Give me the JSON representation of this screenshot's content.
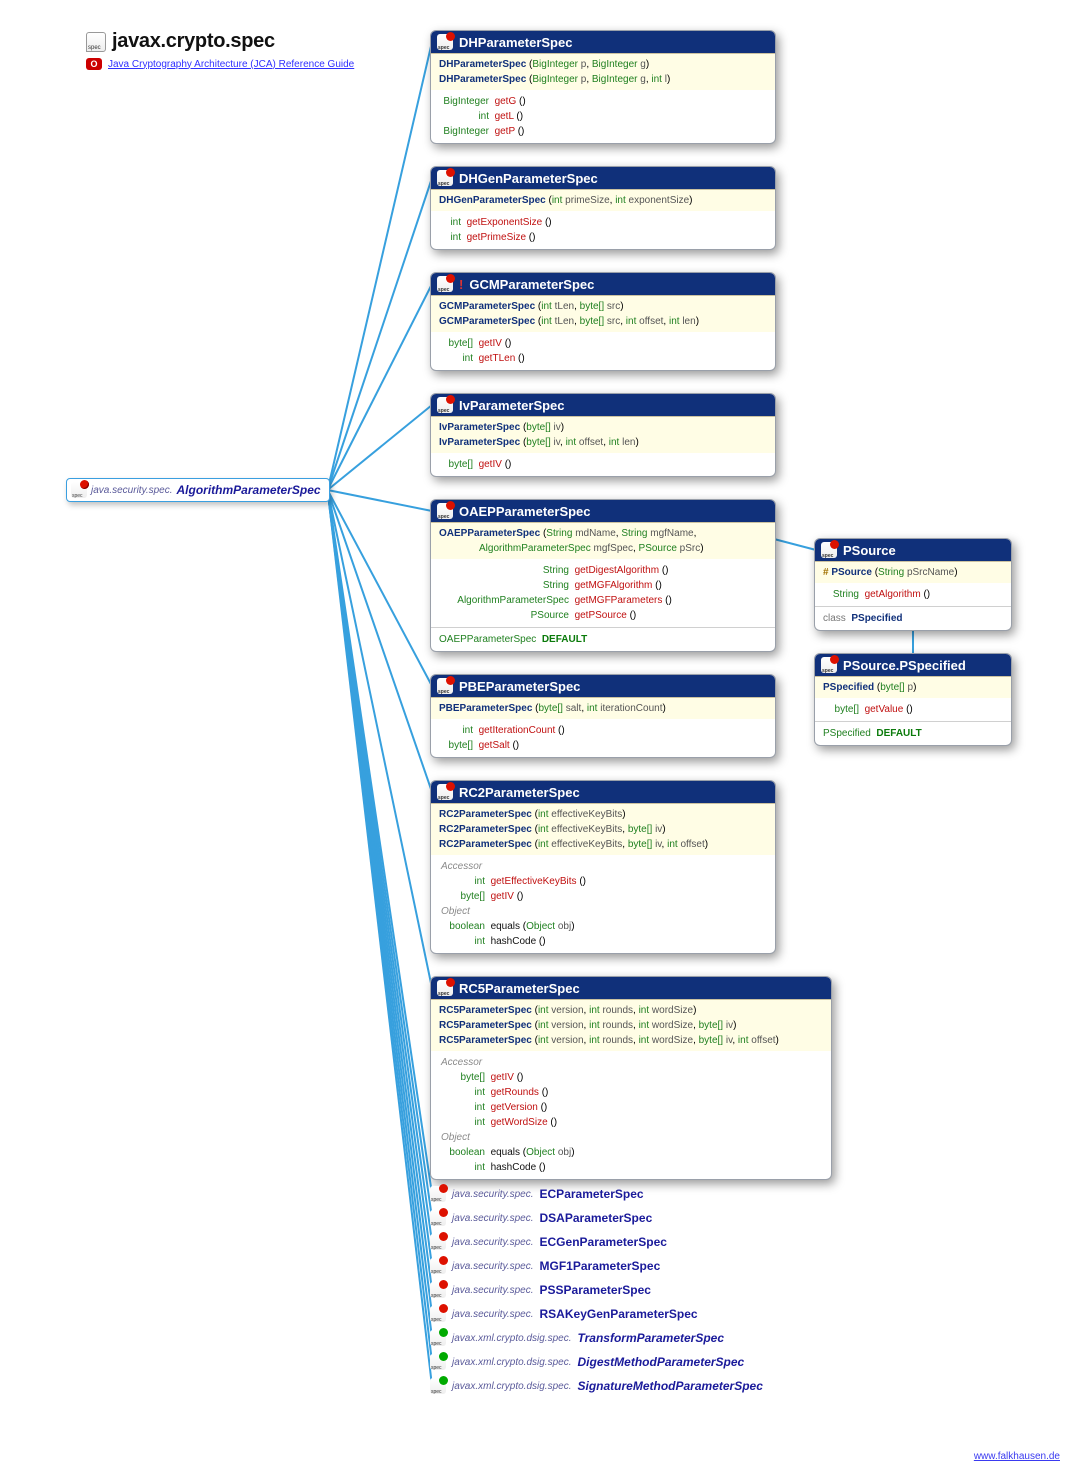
{
  "title": "javax.crypto.spec",
  "reference_link": "Java Cryptography Architecture (JCA) Reference Guide",
  "root": {
    "package": "java.security.spec.",
    "class": "AlgorithmParameterSpec"
  },
  "boxes": [
    {
      "name": "DHParameterSpec",
      "ctors": [
        {
          "n": "DHParameterSpec",
          "args": [
            [
              "BigInteger",
              "p"
            ],
            [
              "BigInteger",
              "g"
            ]
          ]
        },
        {
          "n": "DHParameterSpec",
          "args": [
            [
              "BigInteger",
              "p"
            ],
            [
              "BigInteger",
              "g"
            ],
            [
              "int",
              "l"
            ]
          ]
        }
      ],
      "methods": [
        [
          "BigInteger",
          "getG"
        ],
        [
          "int",
          "getL"
        ],
        [
          "BigInteger",
          "getP"
        ]
      ],
      "rcol": 50
    },
    {
      "name": "DHGenParameterSpec",
      "ctors": [
        {
          "n": "DHGenParameterSpec",
          "args": [
            [
              "int",
              "primeSize"
            ],
            [
              "int",
              "exponentSize"
            ]
          ]
        }
      ],
      "methods": [
        [
          "int",
          "getExponentSize"
        ],
        [
          "int",
          "getPrimeSize"
        ]
      ],
      "rcol": 22
    },
    {
      "name": "GCMParameterSpec",
      "bang": true,
      "ctors": [
        {
          "n": "GCMParameterSpec",
          "args": [
            [
              "int",
              "tLen"
            ],
            [
              "byte[]",
              "src"
            ]
          ]
        },
        {
          "n": "GCMParameterSpec",
          "args": [
            [
              "int",
              "tLen"
            ],
            [
              "byte[]",
              "src"
            ],
            [
              "int",
              "offset"
            ],
            [
              "int",
              "len"
            ]
          ]
        }
      ],
      "methods": [
        [
          "byte[]",
          "getIV"
        ],
        [
          "int",
          "getTLen"
        ]
      ],
      "rcol": 34
    },
    {
      "name": "IvParameterSpec",
      "ctors": [
        {
          "n": "IvParameterSpec",
          "args": [
            [
              "byte[]",
              "iv"
            ]
          ]
        },
        {
          "n": "IvParameterSpec",
          "args": [
            [
              "byte[]",
              "iv"
            ],
            [
              "int",
              "offset"
            ],
            [
              "int",
              "len"
            ]
          ]
        }
      ],
      "methods": [
        [
          "byte[]",
          "getIV"
        ]
      ],
      "rcol": 34
    },
    {
      "name": "OAEPParameterSpec",
      "ctors": [
        {
          "n": "OAEPParameterSpec",
          "args": [
            [
              "String",
              "mdName"
            ],
            [
              "String",
              "mgfName"
            ],
            [
              "AlgorithmParameterSpec",
              "mgfSpec"
            ],
            [
              "PSource",
              "pSrc"
            ]
          ],
          "wrap": true
        }
      ],
      "methods": [
        [
          "String",
          "getDigestAlgorithm"
        ],
        [
          "String",
          "getMGFAlgorithm"
        ],
        [
          "AlgorithmParameterSpec",
          "getMGFParameters"
        ],
        [
          "PSource",
          "getPSource"
        ]
      ],
      "fields": [
        [
          "OAEPParameterSpec",
          "DEFAULT"
        ]
      ],
      "rcol": 130
    },
    {
      "name": "PBEParameterSpec",
      "ctors": [
        {
          "n": "PBEParameterSpec",
          "args": [
            [
              "byte[]",
              "salt"
            ],
            [
              "int",
              "iterationCount"
            ]
          ]
        }
      ],
      "methods": [
        [
          "int",
          "getIterationCount"
        ],
        [
          "byte[]",
          "getSalt"
        ]
      ],
      "rcol": 34
    },
    {
      "name": "RC2ParameterSpec",
      "ctors": [
        {
          "n": "RC2ParameterSpec",
          "args": [
            [
              "int",
              "effectiveKeyBits"
            ]
          ]
        },
        {
          "n": "RC2ParameterSpec",
          "args": [
            [
              "int",
              "effectiveKeyBits"
            ],
            [
              "byte[]",
              "iv"
            ]
          ]
        },
        {
          "n": "RC2ParameterSpec",
          "args": [
            [
              "int",
              "effectiveKeyBits"
            ],
            [
              "byte[]",
              "iv"
            ],
            [
              "int",
              "offset"
            ]
          ]
        }
      ],
      "sections": [
        {
          "label": "Accessor",
          "methods": [
            [
              "int",
              "getEffectiveKeyBits"
            ],
            [
              "byte[]",
              "getIV"
            ]
          ]
        },
        {
          "label": "Object",
          "methods": [
            [
              "boolean",
              "equals",
              [
                [
                  "Object",
                  "obj"
                ]
              ]
            ],
            [
              "int",
              "hashCode"
            ]
          ]
        }
      ],
      "rcol": 46
    },
    {
      "name": "RC5ParameterSpec",
      "wide": true,
      "ctors": [
        {
          "n": "RC5ParameterSpec",
          "args": [
            [
              "int",
              "version"
            ],
            [
              "int",
              "rounds"
            ],
            [
              "int",
              "wordSize"
            ]
          ]
        },
        {
          "n": "RC5ParameterSpec",
          "args": [
            [
              "int",
              "version"
            ],
            [
              "int",
              "rounds"
            ],
            [
              "int",
              "wordSize"
            ],
            [
              "byte[]",
              "iv"
            ]
          ]
        },
        {
          "n": "RC5ParameterSpec",
          "args": [
            [
              "int",
              "version"
            ],
            [
              "int",
              "rounds"
            ],
            [
              "int",
              "wordSize"
            ],
            [
              "byte[]",
              "iv"
            ],
            [
              "int",
              "offset"
            ]
          ]
        }
      ],
      "sections": [
        {
          "label": "Accessor",
          "methods": [
            [
              "byte[]",
              "getIV"
            ],
            [
              "int",
              "getRounds"
            ],
            [
              "int",
              "getVersion"
            ],
            [
              "int",
              "getWordSize"
            ]
          ]
        },
        {
          "label": "Object",
          "methods": [
            [
              "boolean",
              "equals",
              [
                [
                  "Object",
                  "obj"
                ]
              ]
            ],
            [
              "int",
              "hashCode"
            ]
          ]
        }
      ],
      "rcol": 46
    }
  ],
  "psource": {
    "name": "PSource",
    "ctor": {
      "n": "PSource",
      "args": [
        [
          "String",
          "pSrcName"
        ]
      ],
      "prot": true
    },
    "methods": [
      [
        "String",
        "getAlgorithm"
      ]
    ],
    "inner": "PSpecified",
    "rcol": 36
  },
  "pspecified": {
    "name": "PSource.PSpecified",
    "ctor": {
      "n": "PSpecified",
      "args": [
        [
          "byte[]",
          "p"
        ]
      ]
    },
    "methods": [
      [
        "byte[]",
        "getValue"
      ]
    ],
    "fields": [
      [
        "PSpecified",
        "DEFAULT"
      ]
    ],
    "rcol": 36
  },
  "subclasses": [
    {
      "pkg": "java.security.spec.",
      "cls": "ECParameterSpec"
    },
    {
      "pkg": "java.security.spec.",
      "cls": "DSAParameterSpec"
    },
    {
      "pkg": "java.security.spec.",
      "cls": "ECGenParameterSpec"
    },
    {
      "pkg": "java.security.spec.",
      "cls": "MGF1ParameterSpec"
    },
    {
      "pkg": "java.security.spec.",
      "cls": "PSSParameterSpec"
    },
    {
      "pkg": "java.security.spec.",
      "cls": "RSAKeyGenParameterSpec"
    },
    {
      "pkg": "javax.xml.crypto.dsig.spec.",
      "cls": "TransformParameterSpec",
      "italic": true,
      "green": true
    },
    {
      "pkg": "javax.xml.crypto.dsig.spec.",
      "cls": "DigestMethodParameterSpec",
      "italic": true,
      "green": true
    },
    {
      "pkg": "javax.xml.crypto.dsig.spec.",
      "cls": "SignatureMethodParameterSpec",
      "italic": true,
      "green": true
    }
  ],
  "footer": "www.falkhausen.de"
}
